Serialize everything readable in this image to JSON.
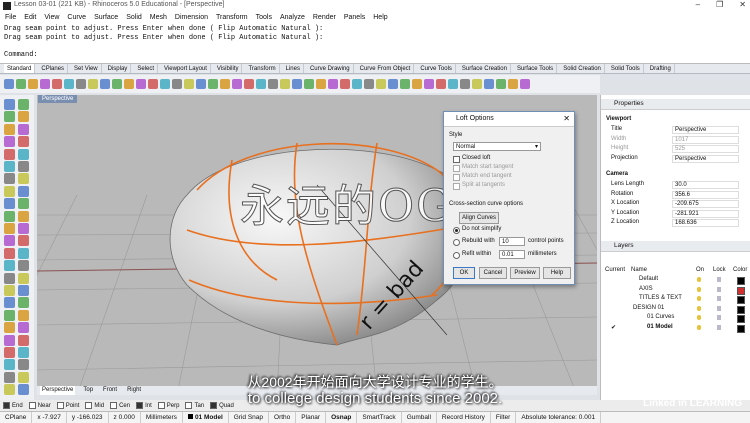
{
  "window": {
    "title": "Lesson 03-01 (221 KB) - Rhinoceros 5.0 Educational - [Perspective]"
  },
  "menu": [
    "File",
    "Edit",
    "View",
    "Curve",
    "Surface",
    "Solid",
    "Mesh",
    "Dimension",
    "Transform",
    "Tools",
    "Analyze",
    "Render",
    "Panels",
    "Help"
  ],
  "command": {
    "lines": [
      "Drag seam point to adjust. Press Enter when done ( Flip  Automatic  Natural ):",
      "Drag seam point to adjust. Press Enter when done ( Flip  Automatic  Natural ):",
      "Command:"
    ]
  },
  "toolbar_tabs": [
    "Standard",
    "CPlanes",
    "Set View",
    "Display",
    "Select",
    "Viewport Layout",
    "Visibility",
    "Transform",
    "Lines",
    "Curve Drawing",
    "Curve From Object",
    "Curve Tools",
    "Surface Creation",
    "Surface Tools",
    "Solid Creation",
    "Solid Tools",
    "Drafting"
  ],
  "viewport": {
    "name": "Perspective",
    "tabs": [
      "Perspective",
      "Top",
      "Front",
      "Right"
    ],
    "annotation": "r = bad"
  },
  "loft_dialog": {
    "title": "Loft Options",
    "style_label": "Style",
    "style_value": "Normal",
    "closed_loft": "Closed loft",
    "match_start": "Match start tangent",
    "match_end": "Match end tangent",
    "split_tangents": "Split at tangents",
    "cross_section_label": "Cross-section curve options",
    "align_curves": "Align Curves",
    "do_not_simplify": "Do not simplify",
    "rebuild_with": "Rebuild with",
    "rebuild_value": "10",
    "control_points": "control points",
    "refit_within": "Refit within",
    "refit_value": "0.01",
    "millimeters": "millimeters",
    "ok": "OK",
    "cancel": "Cancel",
    "preview": "Preview",
    "help": "Help"
  },
  "properties": {
    "title": "Properties",
    "viewport_section": "Viewport",
    "rows": [
      {
        "k": "Title",
        "v": "Perspective"
      },
      {
        "k": "Width",
        "v": "1017"
      },
      {
        "k": "Height",
        "v": "525"
      },
      {
        "k": "Projection",
        "v": "Perspective"
      }
    ],
    "camera_section": "Camera",
    "camera_rows": [
      {
        "k": "Lens Length",
        "v": "30.0"
      },
      {
        "k": "Rotation",
        "v": "356.6"
      },
      {
        "k": "X Location",
        "v": "-209.675"
      },
      {
        "k": "Y Location",
        "v": "-281.921"
      },
      {
        "k": "Z Location",
        "v": "168.636"
      }
    ]
  },
  "layers": {
    "title": "Layers",
    "headers": [
      "Current",
      "Name",
      "On",
      "Lock",
      "Color"
    ],
    "rows": [
      {
        "name": "Default",
        "color": "#000000"
      },
      {
        "name": "AXIS",
        "color": "#d03030"
      },
      {
        "name": "TITLES & TEXT",
        "color": "#000000"
      },
      {
        "name": "DESIGN 01",
        "color": "#000000"
      },
      {
        "name": "01 Curves",
        "color": "#000000"
      },
      {
        "name": "01 Model",
        "color": "#000000",
        "current": "✔"
      }
    ]
  },
  "osnap": [
    {
      "label": "End",
      "on": true
    },
    {
      "label": "Near",
      "on": false
    },
    {
      "label": "Point",
      "on": false
    },
    {
      "label": "Mid",
      "on": false
    },
    {
      "label": "Cen",
      "on": false
    },
    {
      "label": "Int",
      "on": true
    },
    {
      "label": "Perp",
      "on": false
    },
    {
      "label": "Tan",
      "on": false
    },
    {
      "label": "Quad",
      "on": true
    }
  ],
  "statusbar": {
    "cplane": "CPlane",
    "x": "x -7.927",
    "y": "y -166.023",
    "z": "z 0.000",
    "units": "Millimeters",
    "layer": "01 Model",
    "items": [
      "Grid Snap",
      "Ortho",
      "Planar",
      "Osnap",
      "SmartTrack",
      "Gumball",
      "Record History",
      "Filter",
      "Absolute tolerance: 0.001"
    ]
  },
  "overlay": {
    "watermark": "永远的OG",
    "subtitle_cn": "从2002年开始面向大学设计专业的学生。",
    "subtitle_en": "to college design students since 2002.",
    "brand": "Linked in LEARNING"
  }
}
